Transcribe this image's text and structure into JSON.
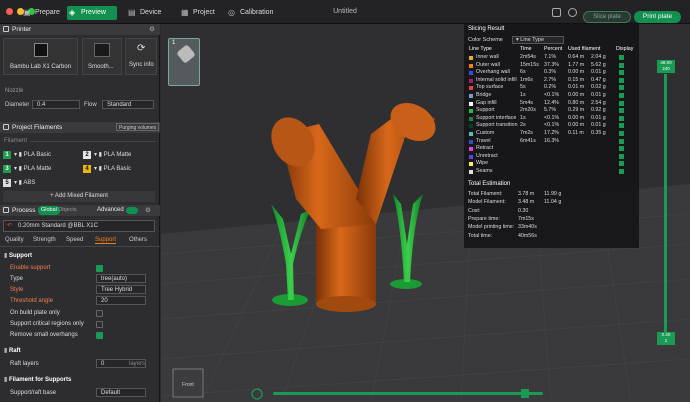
{
  "topbar": {
    "tabs": [
      "Prepare",
      "Preview",
      "Device",
      "Project",
      "Calibration"
    ],
    "title": "Untitled",
    "slice_plate": "Slice plate",
    "print_plate": "Print plate"
  },
  "printer": {
    "header": "Printer",
    "name": "Bambu Lab X1 Carbon",
    "plate": "Smooth...",
    "sync": "Sync info",
    "nozzle_label": "Nozzle",
    "diameter_label": "Diameter",
    "diameter_value": "0.4",
    "flow_label": "Flow",
    "flow_value": "Standard"
  },
  "filaments": {
    "header": "Project Filaments",
    "purging": "Purging volumes",
    "sub": "Filament",
    "items": [
      {
        "num": "1",
        "name": "PLA Basic",
        "color": "#1e9b50"
      },
      {
        "num": "2",
        "name": "PLA Matte",
        "color": "#e6e6e6"
      },
      {
        "num": "3",
        "name": "PLA Matte",
        "color": "#1e9b50"
      },
      {
        "num": "4",
        "name": "PLA Basic",
        "color": "#e6b800"
      },
      {
        "num": "5",
        "name": "ABS",
        "color": "#dddddd"
      }
    ],
    "add_mixed": "Add Mixed Filament"
  },
  "process": {
    "header": "Process",
    "global": "Global",
    "objects": "Objects",
    "advanced": "Advanced",
    "preset": "0.20mm Standard @BBL X1C",
    "tabs": [
      "Quality",
      "Strength",
      "Speed",
      "Support",
      "Others"
    ]
  },
  "support": {
    "header": "Support",
    "enable": "Enable support",
    "type_label": "Type",
    "type_value": "tree(auto)",
    "style_label": "Style",
    "style_value": "Tree Hybrid",
    "threshold_label": "Threshold angle",
    "threshold_value": "20",
    "build_plate": "On build plate only",
    "critical": "Support critical regions only",
    "small": "Remove small overhangs"
  },
  "raft": {
    "header": "Raft",
    "layers_label": "Raft layers",
    "layers_value": "0",
    "layers_unit": "layers"
  },
  "filament_supports": {
    "header": "Filament for Supports",
    "base_label": "Support/raft base",
    "base_value": "Default"
  },
  "slicing": {
    "title": "Slicing Result",
    "color_scheme_label": "Color Scheme",
    "color_scheme_value": "Line Type",
    "cols": [
      "Line Type",
      "Time",
      "Percent",
      "Used filament",
      "Display"
    ],
    "rows": [
      {
        "name": "Inner wall",
        "time": "2m54s",
        "pct": "7.1%",
        "len": "0.64 m",
        "wt": "2.04 g",
        "color": "#e8b020"
      },
      {
        "name": "Outer wall",
        "time": "15m15s",
        "pct": "37.3%",
        "len": "1.77 m",
        "wt": "5.62 g",
        "color": "#f08020"
      },
      {
        "name": "Overhang wall",
        "time": "6s",
        "pct": "0.3%",
        "len": "0.00 m",
        "wt": "0.01 g",
        "color": "#3050e0"
      },
      {
        "name": "Internal solid infill",
        "time": "1m6s",
        "pct": "2.7%",
        "len": "0.15 m",
        "wt": "0.47 g",
        "color": "#a02060"
      },
      {
        "name": "Top surface",
        "time": "5s",
        "pct": "0.2%",
        "len": "0.01 m",
        "wt": "0.02 g",
        "color": "#e84040"
      },
      {
        "name": "Bridge",
        "time": "1s",
        "pct": "<0.1%",
        "len": "0.00 m",
        "wt": "0.01 g",
        "color": "#70a0d0"
      },
      {
        "name": "Gap infill",
        "time": "5m4s",
        "pct": "12.4%",
        "len": "0.80 m",
        "wt": "2.54 g",
        "color": "#ffffff"
      },
      {
        "name": "Support",
        "time": "2m20s",
        "pct": "5.7%",
        "len": "0.29 m",
        "wt": "0.92 g",
        "color": "#20c040"
      },
      {
        "name": "Support interface",
        "time": "1s",
        "pct": "<0.1%",
        "len": "0.00 m",
        "wt": "0.01 g",
        "color": "#208040"
      },
      {
        "name": "Support transition",
        "time": "2s",
        "pct": "<0.1%",
        "len": "0.00 m",
        "wt": "0.01 g",
        "color": "#004020"
      },
      {
        "name": "Custom",
        "time": "7m2s",
        "pct": "17.2%",
        "len": "0.11 m",
        "wt": "0.35 g",
        "color": "#50c0c0"
      },
      {
        "name": "Travel",
        "time": "6m41s",
        "pct": "16.3%",
        "len": "",
        "wt": "",
        "color": "#3050c0"
      },
      {
        "name": "Retract",
        "time": "",
        "pct": "",
        "len": "",
        "wt": "",
        "color": "#e040e0"
      },
      {
        "name": "Unretract",
        "time": "",
        "pct": "",
        "len": "",
        "wt": "",
        "color": "#6040e0"
      },
      {
        "name": "Wipe",
        "time": "",
        "pct": "",
        "len": "",
        "wt": "",
        "color": "#f0f060"
      },
      {
        "name": "Seams",
        "time": "",
        "pct": "",
        "len": "",
        "wt": "",
        "color": "#e0e0e0"
      }
    ],
    "est_title": "Total Estimation",
    "est": [
      {
        "k": "Total Filament:",
        "v": "3.78 m",
        "v2": "11.99 g"
      },
      {
        "k": "Model Filament:",
        "v": "3.48 m",
        "v2": "11.04 g"
      },
      {
        "k": "Cost:",
        "v": "0.30",
        "v2": ""
      },
      {
        "k": "Prepare time:",
        "v": "7m15s",
        "v2": ""
      },
      {
        "k": "Model printing time:",
        "v": "33m40s",
        "v2": ""
      },
      {
        "k": "Total time:",
        "v": "40m56s",
        "v2": ""
      }
    ]
  },
  "slider": {
    "top_value": "48.00",
    "top_layer": "240",
    "bottom_value": "0.20",
    "bottom_layer": "1"
  },
  "plate": {
    "number": "1",
    "view": "Front"
  }
}
